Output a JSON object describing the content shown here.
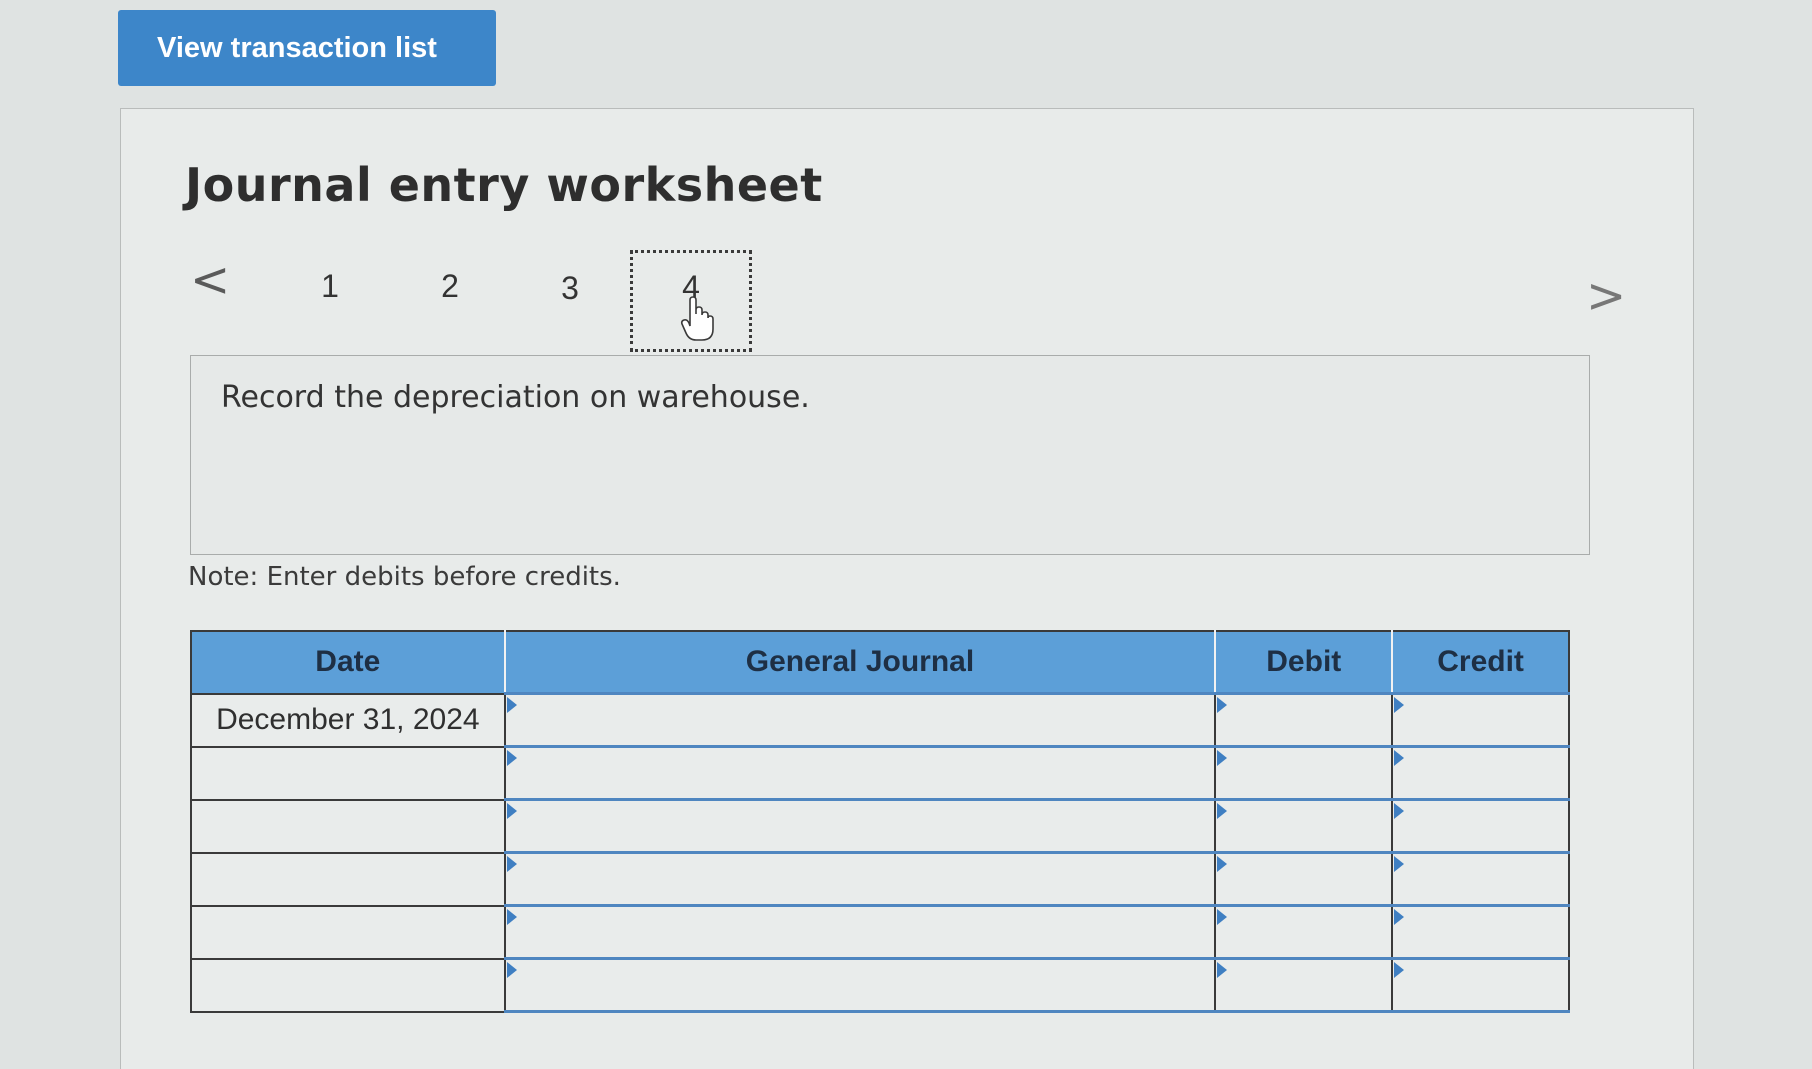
{
  "top_button": {
    "label": "View transaction list"
  },
  "worksheet": {
    "title": "Journal entry worksheet",
    "pagination": {
      "prev_glyph": "<",
      "next_glyph": ">",
      "pages": [
        "1",
        "2",
        "3",
        "4"
      ],
      "current_page": "4"
    },
    "prompt": "Record the depreciation on warehouse.",
    "note": "Note: Enter debits before credits.",
    "table": {
      "headers": {
        "date": "Date",
        "general_journal": "General Journal",
        "debit": "Debit",
        "credit": "Credit"
      },
      "rows": [
        {
          "date": "December 31, 2024",
          "account": "",
          "debit": "",
          "credit": ""
        },
        {
          "date": "",
          "account": "",
          "debit": "",
          "credit": ""
        },
        {
          "date": "",
          "account": "",
          "debit": "",
          "credit": ""
        },
        {
          "date": "",
          "account": "",
          "debit": "",
          "credit": ""
        },
        {
          "date": "",
          "account": "",
          "debit": "",
          "credit": ""
        },
        {
          "date": "",
          "account": "",
          "debit": "",
          "credit": ""
        }
      ]
    }
  },
  "colors": {
    "button_blue": "#3d86c9",
    "header_blue": "#5c9fd8",
    "input_border_blue": "#4f86c0"
  },
  "icons": {
    "prev": "chevron-left-icon",
    "next": "chevron-right-icon",
    "cursor": "hand-pointer-icon"
  }
}
